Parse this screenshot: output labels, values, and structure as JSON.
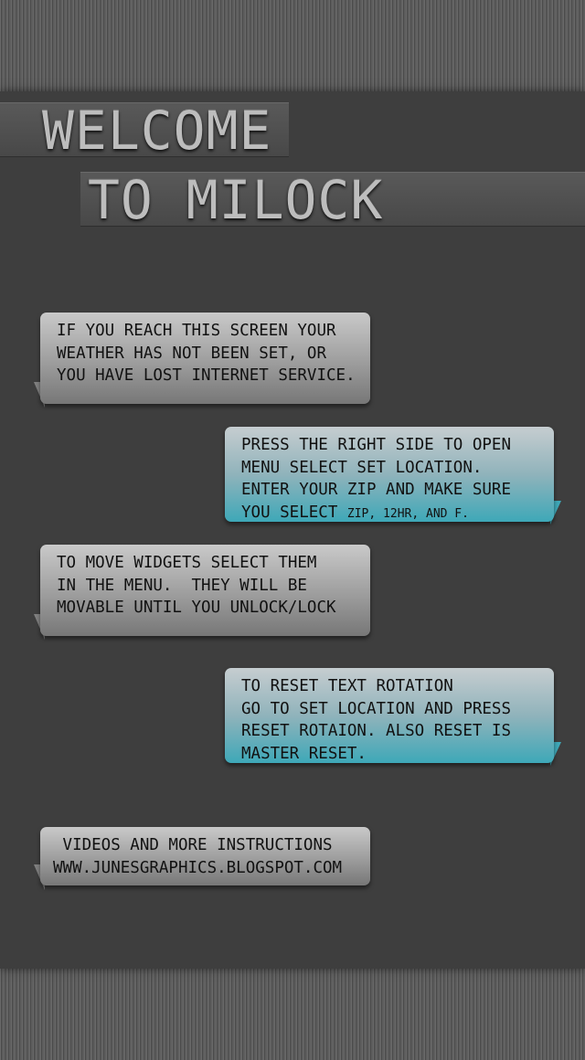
{
  "title": {
    "line1": "WELCOME",
    "line2": "TO MILOCK"
  },
  "messages": [
    {
      "style": "gray",
      "text": "IF YOU REACH THIS SCREEN YOUR\nWEATHER HAS NOT BEEN SET, OR\nYOU HAVE LOST INTERNET SERVICE."
    },
    {
      "style": "blue",
      "text": "PRESS THE RIGHT SIDE TO OPEN\nMENU SELECT SET LOCATION.\nENTER YOUR ZIP AND MAKE SURE\nYOU SELECT ",
      "small": "ZIP, 12HR, AND F."
    },
    {
      "style": "gray",
      "text": "TO MOVE WIDGETS SELECT THEM\nIN THE MENU.  THEY WILL BE\nMOVABLE UNTIL YOU UNLOCK/LOCK"
    },
    {
      "style": "blue",
      "text": "TO RESET TEXT ROTATION\nGO TO SET LOCATION AND PRESS\nRESET ROTAION. ALSO RESET IS\nMASTER RESET."
    },
    {
      "style": "gray",
      "text": " VIDEOS AND MORE INSTRUCTIONS\nWWW.JUNESGRAPHICS.BLOGSPOT.COM"
    }
  ]
}
